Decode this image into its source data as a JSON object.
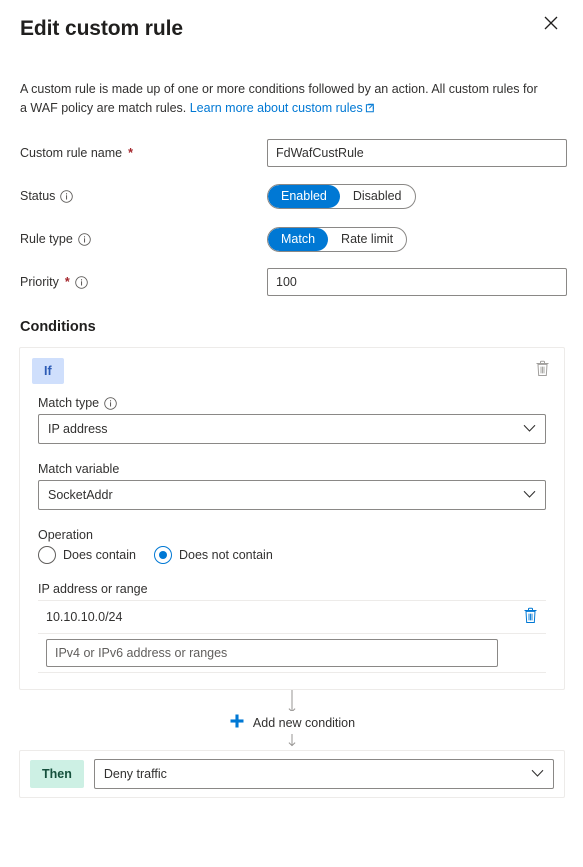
{
  "header": {
    "title": "Edit custom rule",
    "close_label": "Close",
    "close_icon": "close-icon"
  },
  "intro": {
    "text_before": "A custom rule is made up of one or more conditions followed by an action. All custom rules for a WAF policy are match rules. ",
    "link_text": "Learn more about custom rules",
    "link_icon": "external-link-icon"
  },
  "form": {
    "rule_name": {
      "label": "Custom rule name",
      "required_marker": "*",
      "value": "FdWafCustRule"
    },
    "status": {
      "label": "Status",
      "info_icon": "info-icon",
      "options": [
        "Enabled",
        "Disabled"
      ],
      "selected": "Enabled"
    },
    "rule_type": {
      "label": "Rule type",
      "info_icon": "info-icon",
      "options": [
        "Match",
        "Rate limit"
      ],
      "selected": "Match"
    },
    "priority": {
      "label": "Priority",
      "required_marker": "*",
      "info_icon": "info-icon",
      "value": "100"
    }
  },
  "conditions": {
    "section_title": "Conditions",
    "card": {
      "badge": "If",
      "delete_icon": "trash-icon",
      "delete_label": "Delete condition",
      "match_type": {
        "label": "Match type",
        "info_icon": "info-icon",
        "value": "IP address",
        "chevron_icon": "chevron-down-icon"
      },
      "match_variable": {
        "label": "Match variable",
        "value": "SocketAddr",
        "chevron_icon": "chevron-down-icon"
      },
      "operation": {
        "label": "Operation",
        "options": [
          "Does contain",
          "Does not contain"
        ],
        "selected": "Does not contain"
      },
      "ip_addresses": {
        "label": "IP address or range",
        "entries": [
          {
            "value": "10.10.10.0/24",
            "delete_icon": "trash-icon"
          }
        ],
        "new_entry_placeholder": "IPv4 or IPv6 address or ranges",
        "new_entry_value": ""
      }
    },
    "add_condition": {
      "label": "Add new condition",
      "icon": "plus-icon"
    },
    "then": {
      "badge": "Then",
      "action_value": "Deny traffic",
      "chevron_icon": "chevron-down-icon"
    }
  },
  "colors": {
    "accent_blue": "#0078d4",
    "link_blue": "#0078d4",
    "required_red": "#a4262c",
    "if_badge_bg": "#cfdffc",
    "if_badge_text": "#2c5bb5",
    "then_badge_bg": "#cdf0e4",
    "then_badge_text": "#15503c",
    "border_grey": "#8a8886",
    "divider_grey": "#edebe9"
  }
}
